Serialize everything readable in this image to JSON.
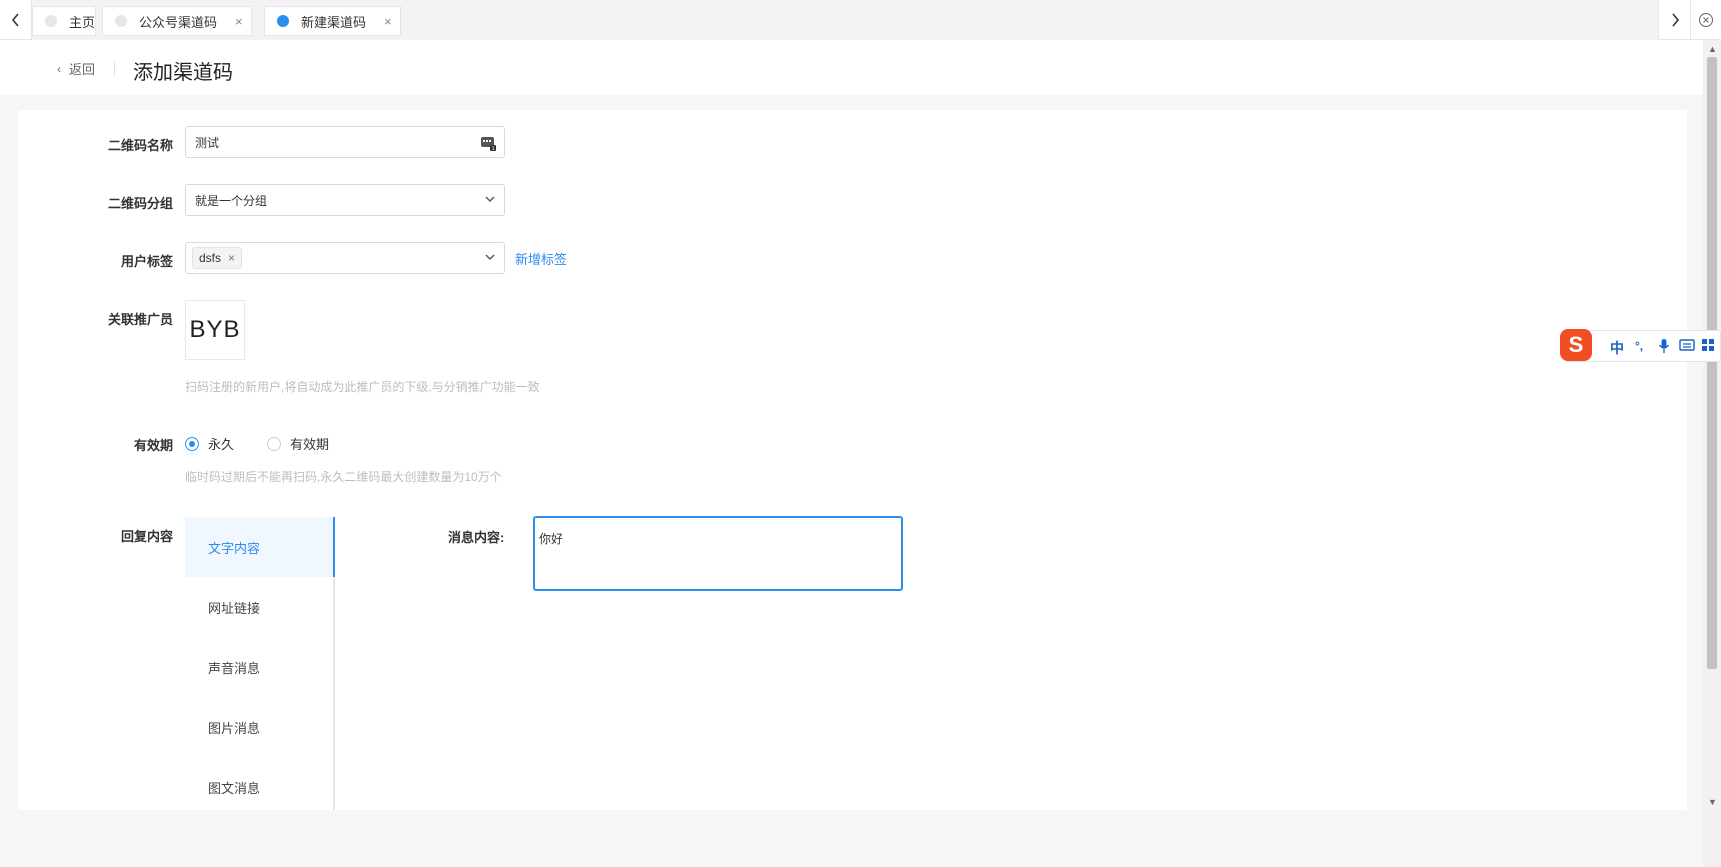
{
  "tabs": [
    {
      "label": "主页",
      "active": false,
      "closable": false
    },
    {
      "label": "公众号渠道码",
      "active": false,
      "closable": true
    },
    {
      "label": "新建渠道码",
      "active": true,
      "closable": true
    }
  ],
  "tab_close_glyph": "×",
  "header": {
    "back_label": "返回",
    "title": "添加渠道码"
  },
  "form": {
    "qr_name": {
      "label": "二维码名称",
      "value": "测试"
    },
    "qr_group": {
      "label": "二维码分组",
      "value": "就是一个分组"
    },
    "user_tags": {
      "label": "用户标签",
      "tags": [
        "dsfs"
      ],
      "add_link": "新增标签"
    },
    "promoter": {
      "label": "关联推广员",
      "avatar_text": "BYB",
      "hint": "扫码注册的新用户,将自动成为此推广员的下级,与分销推广功能一致"
    },
    "validity": {
      "label": "有效期",
      "options": [
        "永久",
        "有效期"
      ],
      "selected": "永久",
      "hint": "临时码过期后不能再扫码,永久二维码最大创建数量为10万个"
    },
    "reply": {
      "label": "回复内容",
      "types": [
        "文字内容",
        "网址链接",
        "声音消息",
        "图片消息",
        "图文消息"
      ],
      "active_type": "文字内容",
      "message_label": "消息内容:",
      "message_value": "你好"
    }
  },
  "ime": {
    "logo": "S",
    "lang": "中",
    "punct": "°,"
  },
  "colors": {
    "accent": "#2d8cf0",
    "hint": "#bdbdbd",
    "background": "#f5f6f8"
  }
}
